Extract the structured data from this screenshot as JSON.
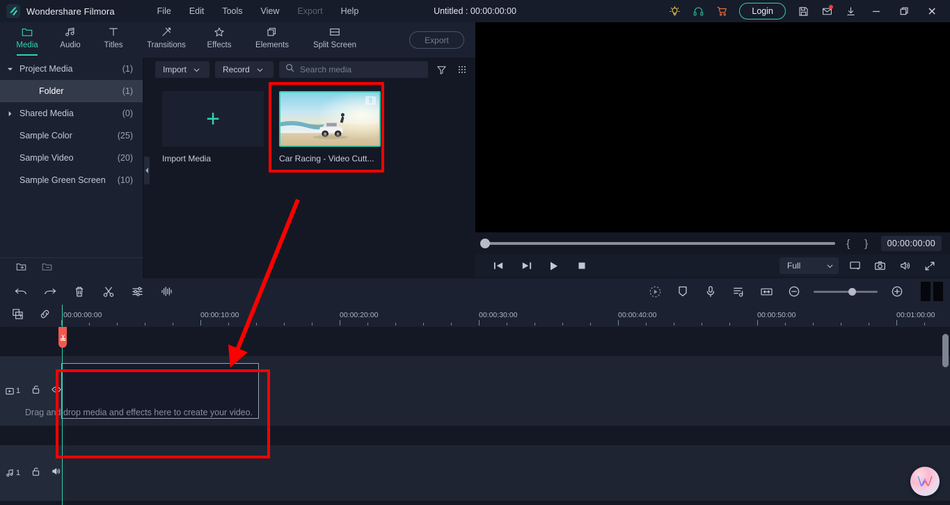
{
  "titlebar": {
    "brand": "Wondershare Filmora",
    "project_title": "Untitled : 00:00:00:00",
    "menus": [
      {
        "label": "File",
        "disabled": false
      },
      {
        "label": "Edit",
        "disabled": false
      },
      {
        "label": "Tools",
        "disabled": false
      },
      {
        "label": "View",
        "disabled": false
      },
      {
        "label": "Export",
        "disabled": true
      },
      {
        "label": "Help",
        "disabled": false
      }
    ],
    "login_label": "Login",
    "icons": [
      "tips-lightbulb-icon",
      "support-headphones-icon",
      "shopping-cart-icon",
      "save-project-icon",
      "inbox-mail-icon",
      "download-icon"
    ],
    "window_controls": [
      "minimize-icon",
      "restore-icon",
      "close-icon"
    ],
    "accent_teal": "#2fd3b0",
    "lightbulb_color": "#e8c547",
    "headphone_color": "#2fb39a",
    "cart_color": "#e8703a",
    "mail_dot_color": "#ef3e36"
  },
  "tabs": [
    {
      "label": "Media",
      "icon": "folder-icon",
      "active": true
    },
    {
      "label": "Audio",
      "icon": "music-note-icon",
      "active": false
    },
    {
      "label": "Titles",
      "icon": "text-t-icon",
      "active": false
    },
    {
      "label": "Transitions",
      "icon": "transition-arrow-icon",
      "active": false
    },
    {
      "label": "Effects",
      "icon": "effects-star-icon",
      "active": false
    },
    {
      "label": "Elements",
      "icon": "elements-layers-icon",
      "active": false
    },
    {
      "label": "Split Screen",
      "icon": "split-screen-icon",
      "active": false
    }
  ],
  "export_button": "Export",
  "sidebar": {
    "items": [
      {
        "label": "Project Media",
        "count": "(1)",
        "arrow": "down",
        "indent": false,
        "selected": false
      },
      {
        "label": "Folder",
        "count": "(1)",
        "arrow": "none",
        "indent": true,
        "selected": true
      },
      {
        "label": "Shared Media",
        "count": "(0)",
        "arrow": "right",
        "indent": false,
        "selected": false
      },
      {
        "label": "Sample Color",
        "count": "(25)",
        "arrow": "none",
        "indent": false,
        "selected": false
      },
      {
        "label": "Sample Video",
        "count": "(20)",
        "arrow": "none",
        "indent": false,
        "selected": false
      },
      {
        "label": "Sample Green Screen",
        "count": "(10)",
        "arrow": "none",
        "indent": false,
        "selected": false
      }
    ],
    "footer_icons": [
      "new-folder-icon",
      "delete-folder-icon"
    ]
  },
  "media_panel": {
    "import_label": "Import",
    "record_label": "Record",
    "search_placeholder": "Search media",
    "search_value": "",
    "filter_icon": "filter-funnel-icon",
    "view_icon": "grid-view-icon",
    "tiles": [
      {
        "caption": "Import Media",
        "type": "import-placeholder",
        "selected": false
      },
      {
        "caption": "Car Racing - Video Cutt...",
        "type": "video-clip",
        "selected": true
      }
    ]
  },
  "preview": {
    "timecode": "00:00:00:00",
    "mark_in": "{",
    "mark_out": "}",
    "quality_label": "Full",
    "controls": [
      "previous-frame-icon",
      "next-frame-icon",
      "play-icon",
      "stop-icon"
    ],
    "right_controls": [
      "snapshot-screen-icon",
      "camera-icon",
      "volume-icon",
      "fullscreen-icon"
    ],
    "scrub_position_pct": 0
  },
  "timeline_toolbar": {
    "left_icons": [
      "undo-icon",
      "redo-icon",
      "delete-icon",
      "split-scissors-icon",
      "adjust-sliders-icon",
      "audio-waveform-icon"
    ],
    "right_icons": [
      "render-preview-icon",
      "marker-icon",
      "voiceover-mic-icon",
      "audio-mixer-icon",
      "fit-timeline-icon"
    ],
    "zoom_out_icon": "zoom-out-icon",
    "zoom_in_icon": "zoom-in-icon",
    "zoom_value_pct": 55
  },
  "timeline": {
    "head_icons": [
      "add-track-icon",
      "link-toggle-icon"
    ],
    "ruler_labels": [
      "00:00:00:00",
      "00:00:10:00",
      "00:00:20:00",
      "00:00:30:00",
      "00:00:40:00",
      "00:00:50:00",
      "00:01:00:00"
    ],
    "dropzone_text": "Drag and drop media and effects here to create your video.",
    "video_track": {
      "number": "1",
      "lock": "unlocked-icon",
      "visibility": "eye-icon"
    },
    "audio_track": {
      "number": "1",
      "lock": "unlocked-icon",
      "mute": "speaker-icon"
    },
    "playhead_time": "00:00:00:00"
  },
  "annotations": {
    "color": "#ff0000",
    "shapes": [
      "media-tile-highlight-rect",
      "timeline-dropzone-highlight-rect",
      "pointer-arrow"
    ]
  },
  "floating_button": {
    "name": "filmora-assistant-w-logo"
  }
}
